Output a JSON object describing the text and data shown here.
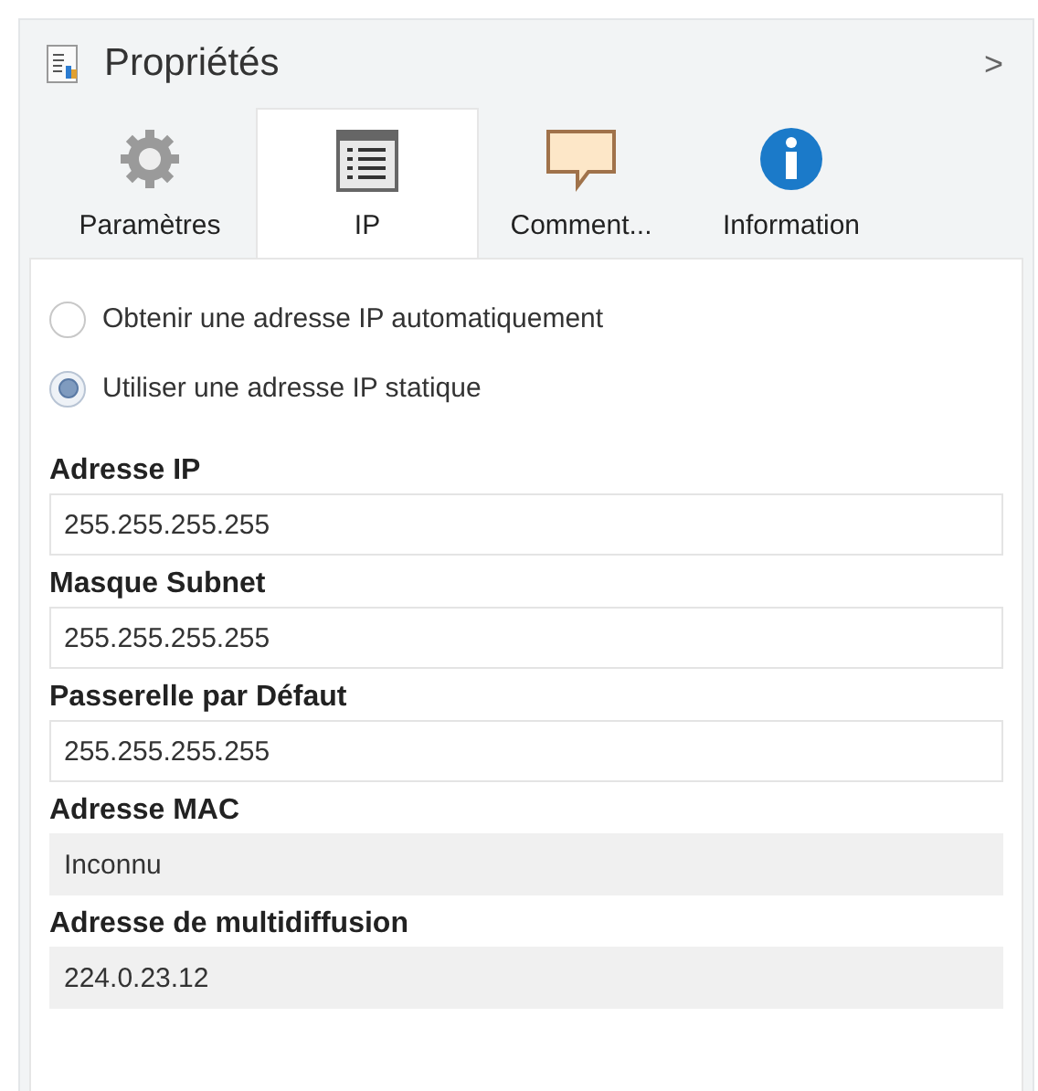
{
  "panel": {
    "title": "Propriétés",
    "collapse_glyph": ">"
  },
  "tabs": [
    {
      "label": "Paramètres",
      "selected": false
    },
    {
      "label": "IP",
      "selected": true
    },
    {
      "label": "Comment...",
      "selected": false
    },
    {
      "label": "Information",
      "selected": false
    }
  ],
  "radios": [
    {
      "label": "Obtenir une adresse IP automatiquement",
      "selected": false
    },
    {
      "label": "Utiliser une adresse IP statique",
      "selected": true
    }
  ],
  "fields": [
    {
      "label": "Adresse IP",
      "value": "255.255.255.255",
      "disabled": false
    },
    {
      "label": "Masque Subnet",
      "value": "255.255.255.255",
      "disabled": false
    },
    {
      "label": "Passerelle par Défaut",
      "value": "255.255.255.255",
      "disabled": false
    },
    {
      "label": "Adresse MAC",
      "value": "Inconnu",
      "disabled": true
    },
    {
      "label": "Adresse de multidiffusion",
      "value": "224.0.23.12",
      "disabled": true
    }
  ]
}
